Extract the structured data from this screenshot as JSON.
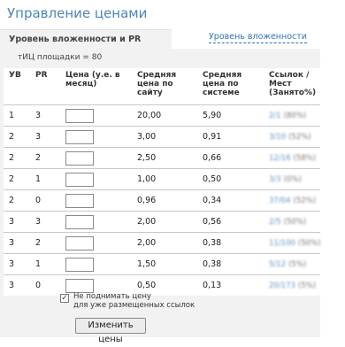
{
  "page": {
    "title": "Управление ценами"
  },
  "tabs": {
    "active_label": "Уровень вложенности и PR",
    "link_label": "Уровень вложенности"
  },
  "tic": "тИЦ площадки = 80",
  "table": {
    "headers": {
      "uv": "УВ",
      "pr": "PR",
      "price": "Цена (у.е. в месяц)",
      "avg_site": "Средняя цена по сайту",
      "avg_system": "Средняя цена по системе",
      "links": "Ссылок / Мест (Занято%)"
    },
    "rows": [
      {
        "uv": "1",
        "pr": "3",
        "price": "",
        "avg_site": "20,00",
        "avg_system": "5,90",
        "links": "2/1",
        "pct": "(80%)"
      },
      {
        "uv": "2",
        "pr": "3",
        "price": "",
        "avg_site": "3,00",
        "avg_system": "0,91",
        "links": "3/10",
        "pct": "(52%)"
      },
      {
        "uv": "2",
        "pr": "2",
        "price": "",
        "avg_site": "2,50",
        "avg_system": "0,66",
        "links": "12/16",
        "pct": "(58%)"
      },
      {
        "uv": "2",
        "pr": "1",
        "price": "",
        "avg_site": "1,00",
        "avg_system": "0,50",
        "links": "3/3",
        "pct": "(0%)"
      },
      {
        "uv": "2",
        "pr": "0",
        "price": "",
        "avg_site": "0,96",
        "avg_system": "0,34",
        "links": "37/04",
        "pct": "(52%)"
      },
      {
        "uv": "3",
        "pr": "3",
        "price": "",
        "avg_site": "2,00",
        "avg_system": "0,56",
        "links": "2/5",
        "pct": "(50%)"
      },
      {
        "uv": "3",
        "pr": "2",
        "price": "",
        "avg_site": "2,00",
        "avg_system": "0,38",
        "links": "11/100",
        "pct": "(50%)"
      },
      {
        "uv": "3",
        "pr": "1",
        "price": "",
        "avg_site": "1,50",
        "avg_system": "0,38",
        "links": "5/12",
        "pct": "(5%)"
      },
      {
        "uv": "3",
        "pr": "0",
        "price": "",
        "avg_site": "0,50",
        "avg_system": "0,13",
        "links": "20/173",
        "pct": "(5%)"
      }
    ]
  },
  "option": {
    "checked": true,
    "label_line1": "Не поднимать цену",
    "label_line2": "для уже размещенных ссылок"
  },
  "submit": {
    "label": "Изменить цены"
  }
}
